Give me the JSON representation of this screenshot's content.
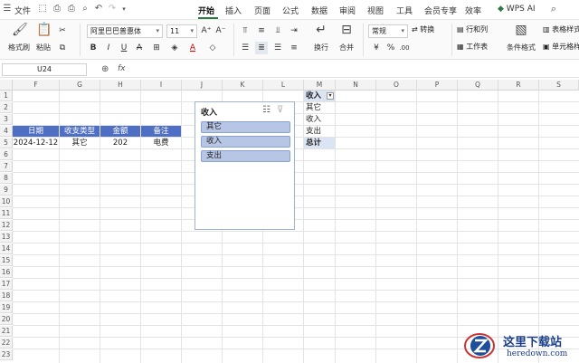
{
  "titlebar": {
    "file_label": "文件",
    "tabs": [
      "开始",
      "插入",
      "页面",
      "公式",
      "数据",
      "审阅",
      "视图",
      "工具",
      "会员专享",
      "效率"
    ],
    "wps_ai": "WPS AI"
  },
  "ribbon": {
    "format_painter": "格式刷",
    "paste": "粘贴",
    "font_name": "阿里巴巴普惠体",
    "font_size": "11",
    "wrap": "换行",
    "merge": "合并",
    "number_format": "常规",
    "convert": "转换",
    "row_col": "行和列",
    "worksheet": "工作表",
    "cond_format": "条件格式",
    "table_style": "表格样式",
    "cell_style": "单元格样式",
    "bold": "B",
    "italic": "I",
    "underline": "U",
    "font_color_letter": "A"
  },
  "formula_bar": {
    "name_box": "U24",
    "fx": "fx"
  },
  "columns": [
    "F",
    "G",
    "H",
    "I",
    "J",
    "K",
    "L",
    "M",
    "N",
    "O",
    "P",
    "Q",
    "R",
    "S"
  ],
  "rows": [
    "1",
    "2",
    "3",
    "4",
    "5",
    "6",
    "7",
    "8",
    "9",
    "10",
    "11",
    "12",
    "13",
    "14",
    "15",
    "16",
    "17",
    "18",
    "19",
    "20",
    "21",
    "22",
    "23"
  ],
  "table": {
    "headers": [
      "日期",
      "收支类型",
      "金额",
      "备注"
    ],
    "row": [
      "2024-12-12",
      "其它",
      "202",
      "电费"
    ]
  },
  "pivot": {
    "header": "收入",
    "items": [
      "其它",
      "收入",
      "支出"
    ],
    "total": "总计"
  },
  "slicer": {
    "title": "收入",
    "items": [
      "其它",
      "收入",
      "支出"
    ]
  },
  "watermark": {
    "name": "这里下载站",
    "url": "heredown.com"
  },
  "colors": {
    "accent": "#2a7a3f",
    "table_header": "#4f6fc4",
    "slicer_item": "#b6c6e4"
  }
}
